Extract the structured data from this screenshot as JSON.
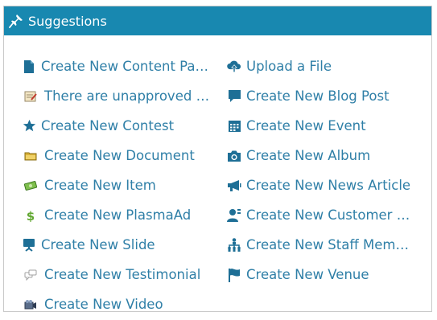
{
  "panel": {
    "title": "Suggestions",
    "header_color": "#1888b0",
    "link_color": "#2f7fa7"
  },
  "left_items": [
    {
      "label": "Create New Content Page",
      "icon": "document-icon"
    },
    {
      "label": "There are unapproved b...",
      "icon": "notepad-icon"
    },
    {
      "label": "Create New Contest",
      "icon": "star-icon"
    },
    {
      "label": "Create New Document",
      "icon": "folder-icon"
    },
    {
      "label": "Create New Item",
      "icon": "money-icon"
    },
    {
      "label": "Create New PlasmaAd",
      "icon": "dollar-icon"
    },
    {
      "label": "Create New Slide",
      "icon": "presentation-icon"
    },
    {
      "label": "Create New Testimonial",
      "icon": "speech-bubbles-icon"
    },
    {
      "label": "Create New Video",
      "icon": "video-camera-icon"
    }
  ],
  "right_items": [
    {
      "label": "Upload a File",
      "icon": "cloud-upload-icon"
    },
    {
      "label": "Create New Blog Post",
      "icon": "comment-icon"
    },
    {
      "label": "Create New Event",
      "icon": "calendar-icon"
    },
    {
      "label": "Create New Album",
      "icon": "camera-icon"
    },
    {
      "label": "Create New News Article",
      "icon": "megaphone-icon"
    },
    {
      "label": "Create New Customer R...",
      "icon": "user-card-icon"
    },
    {
      "label": "Create New Staff Member",
      "icon": "org-chart-icon"
    },
    {
      "label": "Create New Venue",
      "icon": "flag-icon"
    }
  ]
}
